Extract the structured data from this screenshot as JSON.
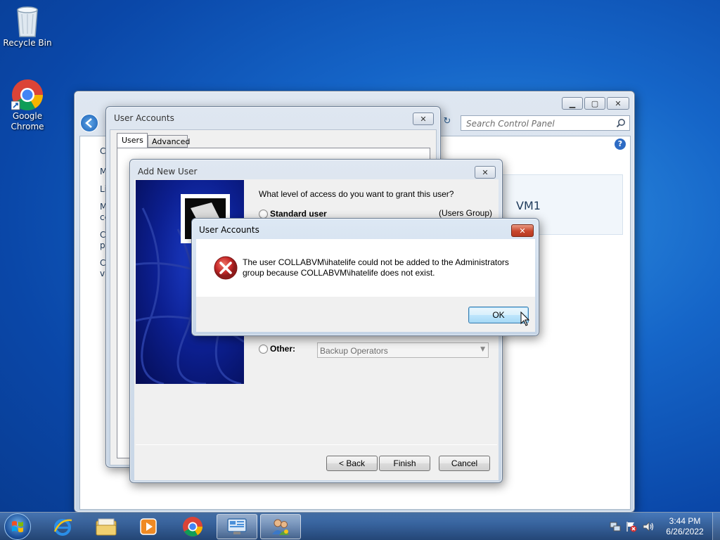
{
  "desktop": {
    "icons": [
      {
        "label": "Recycle Bin"
      },
      {
        "label": "Google\nChrome"
      }
    ]
  },
  "control_panel": {
    "search_placeholder": "Search Control Panel",
    "partial_left": [
      "C",
      "M",
      "Li",
      "M",
      "ce",
      "C",
      "pu",
      "C",
      "va"
    ],
    "vm_label": "VM1"
  },
  "user_accounts_dialog": {
    "title": "User Accounts",
    "tabs": [
      {
        "label": "Users"
      },
      {
        "label": "Advanced"
      }
    ]
  },
  "add_new_user": {
    "title": "Add New User",
    "question": "What level of access do you want to grant this user?",
    "standard_user": {
      "label": "Standard user",
      "group": "(Users Group)"
    },
    "other": {
      "label": "Other:",
      "selected": "Backup Operators"
    },
    "buttons": {
      "back": "< Back",
      "finish": "Finish",
      "cancel": "Cancel"
    }
  },
  "error_dialog": {
    "title": "User Accounts",
    "message_line1": "The user COLLABVM\\ihatelife could not be added to the Administrators",
    "message_line2": "group because COLLABVM\\ihatelife does not exist.",
    "ok": "OK"
  },
  "taskbar": {
    "clock_time": "3:44 PM",
    "clock_date": "6/26/2022",
    "apps": [
      "internet-explorer",
      "windows-explorer",
      "windows-media-player",
      "google-chrome",
      "control-panel",
      "user-accounts"
    ]
  },
  "colors": {
    "error_red": "#c62828",
    "accent_blue": "#3c7fb1"
  }
}
